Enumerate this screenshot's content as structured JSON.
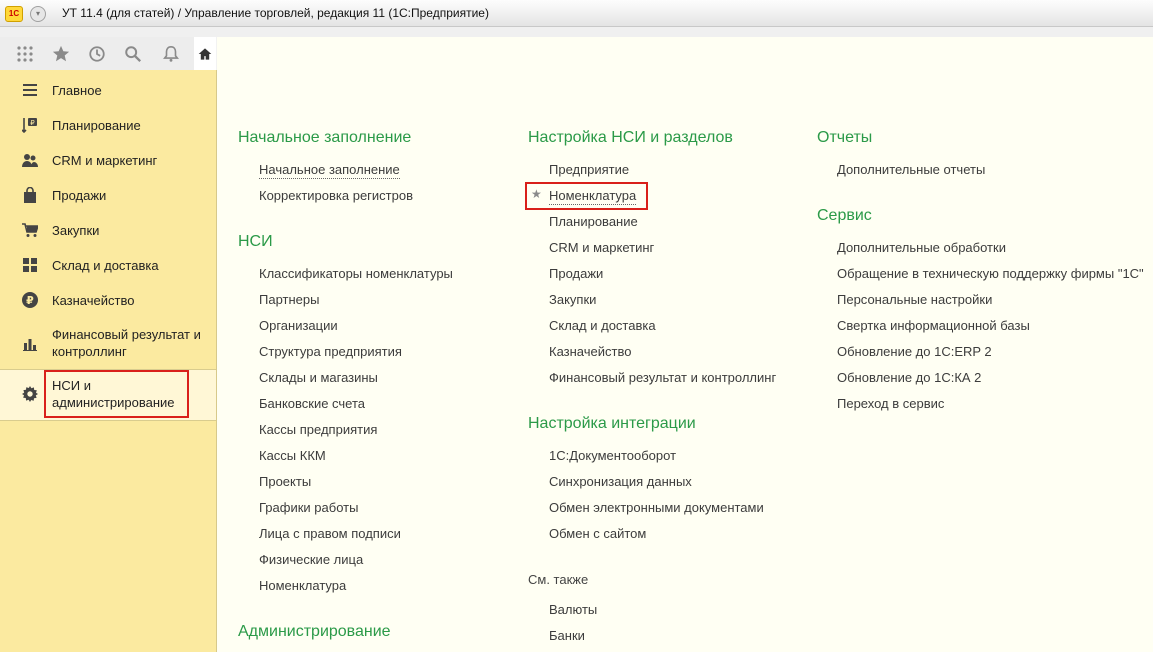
{
  "window": {
    "title": "УТ 11.4 (для статей) / Управление торговлей, редакция 11  (1С:Предприятие)",
    "logo_text": "1С"
  },
  "toolbar": {
    "icons": [
      "apps-grid-icon",
      "star-icon",
      "history-icon",
      "search-icon",
      "bell-icon",
      "home-icon"
    ]
  },
  "sidebar": {
    "items": [
      {
        "label": "Главное",
        "icon": "menu-lines-icon"
      },
      {
        "label": "Планирование",
        "icon": "planning-icon"
      },
      {
        "label": "CRM и маркетинг",
        "icon": "crm-icon"
      },
      {
        "label": "Продажи",
        "icon": "bag-icon"
      },
      {
        "label": "Закупки",
        "icon": "cart-icon"
      },
      {
        "label": "Склад и доставка",
        "icon": "warehouse-icon"
      },
      {
        "label": "Казначейство",
        "icon": "ruble-icon"
      },
      {
        "label": "Финансовый результат и\nконтроллинг",
        "icon": "bar-chart-icon"
      },
      {
        "label": "НСИ и\nадминистрирование",
        "icon": "gear-icon"
      }
    ]
  },
  "main": {
    "col1": {
      "sections": [
        {
          "title": "Начальное заполнение",
          "links": [
            "Начальное заполнение",
            "Корректировка регистров"
          ]
        },
        {
          "title": "НСИ",
          "links": [
            "Классификаторы номенклатуры",
            "Партнеры",
            "Организации",
            "Структура предприятия",
            "Склады и магазины",
            "Банковские счета",
            "Кассы предприятия",
            "Кассы ККМ",
            "Проекты",
            "Графики работы",
            "Лица с правом подписи",
            "Физические лица",
            "Номенклатура"
          ]
        },
        {
          "title": "Администрирование",
          "links": []
        }
      ]
    },
    "col2": {
      "sections": [
        {
          "title": "Настройка НСИ и разделов",
          "links": [
            "Предприятие",
            "Номенклатура",
            "Планирование",
            "CRM и маркетинг",
            "Продажи",
            "Закупки",
            "Склад и доставка",
            "Казначейство",
            "Финансовый результат и контроллинг"
          ]
        },
        {
          "title": "Настройка интеграции",
          "links": [
            "1С:Документооборот",
            "Синхронизация данных",
            "Обмен электронными документами",
            "Обмен с сайтом"
          ]
        }
      ],
      "see_also": {
        "title": "См. также",
        "links": [
          "Валюты",
          "Банки"
        ]
      }
    },
    "col3": {
      "sections": [
        {
          "title": "Отчеты",
          "links": [
            "Дополнительные отчеты"
          ]
        },
        {
          "title": "Сервис",
          "links": [
            "Дополнительные обработки",
            "Обращение в техническую поддержку фирмы \"1С\"",
            "Персональные настройки",
            "Свертка информационной базы",
            "Обновление до 1С:ERP 2",
            "Обновление до 1С:КА 2",
            "Переход в сервис"
          ]
        }
      ]
    }
  },
  "colors": {
    "accent_green": "#2b9a48",
    "sidebar_bg": "#fbeaa0",
    "highlight_red": "#d9201a"
  }
}
